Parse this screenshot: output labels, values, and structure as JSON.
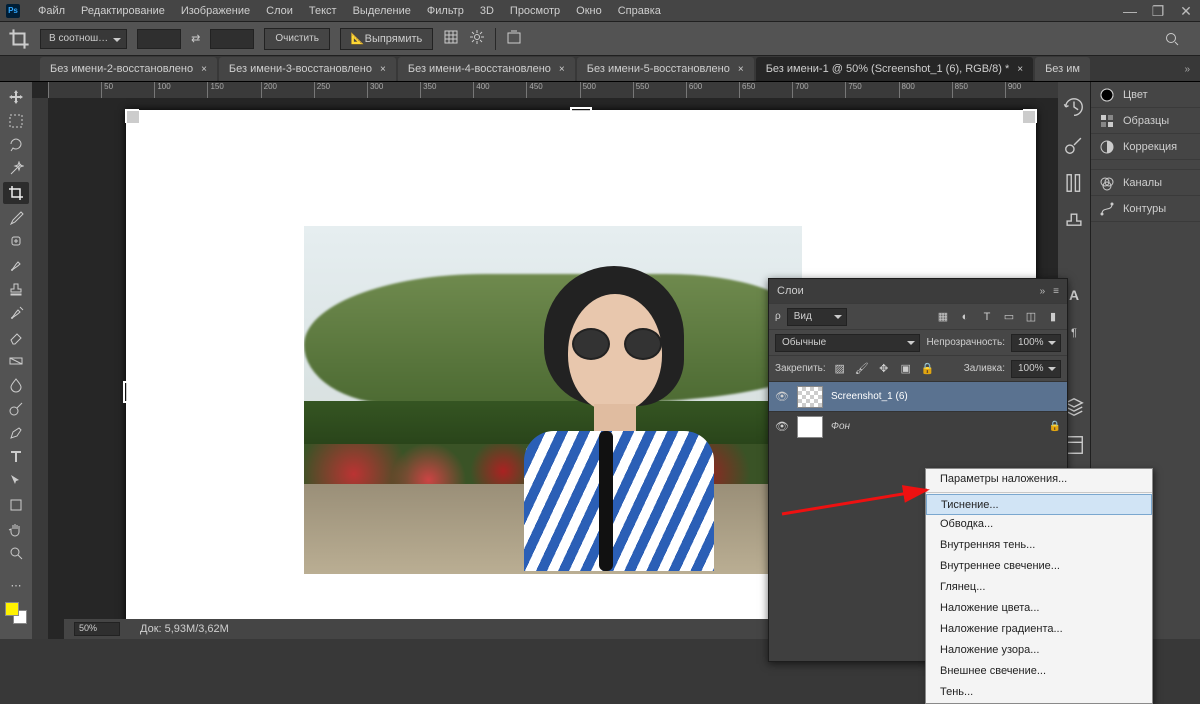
{
  "app": {
    "name": "Ps"
  },
  "menu": [
    "Файл",
    "Редактирование",
    "Изображение",
    "Слои",
    "Текст",
    "Выделение",
    "Фильтр",
    "3D",
    "Просмотр",
    "Окно",
    "Справка"
  ],
  "optbar": {
    "ratio_mode": "В соотнош…",
    "width": "",
    "height": "",
    "clear": "Очистить",
    "straighten": "Выпрямить"
  },
  "tabs": [
    {
      "label": "Без имени-2-восстановлено",
      "active": false
    },
    {
      "label": "Без имени-3-восстановлено",
      "active": false
    },
    {
      "label": "Без имени-4-восстановлено",
      "active": false
    },
    {
      "label": "Без имени-5-восстановлено",
      "active": false
    },
    {
      "label": "Без имени-1 @ 50% (Screenshot_1 (6), RGB/8) *",
      "active": true
    },
    {
      "label": "Без им",
      "active": false
    }
  ],
  "right_panels": [
    "Цвет",
    "Образцы",
    "Коррекция",
    "Каналы",
    "Контуры"
  ],
  "layers_panel": {
    "title": "Слои",
    "kind_label": "Вид",
    "blend_mode": "Обычные",
    "opacity_label": "Непрозрачность:",
    "opacity_value": "100%",
    "lock_label": "Закрепить:",
    "fill_label": "Заливка:",
    "fill_value": "100%",
    "layers": [
      {
        "name": "Screenshot_1 (6)",
        "thumb": "photo",
        "active": true,
        "locked": false
      },
      {
        "name": "Фон",
        "thumb": "white",
        "active": false,
        "locked": true
      }
    ]
  },
  "context_menu": {
    "items": [
      {
        "label": "Параметры наложения...",
        "hl": false
      },
      {
        "sep": true
      },
      {
        "label": "Тиснение...",
        "hl": true
      },
      {
        "label": "Обводка...",
        "hl": false
      },
      {
        "label": "Внутренняя тень...",
        "hl": false
      },
      {
        "label": "Внутреннее свечение...",
        "hl": false
      },
      {
        "label": "Глянец...",
        "hl": false
      },
      {
        "label": "Наложение цвета...",
        "hl": false
      },
      {
        "label": "Наложение градиента...",
        "hl": false
      },
      {
        "label": "Наложение узора...",
        "hl": false
      },
      {
        "label": "Внешнее свечение...",
        "hl": false
      },
      {
        "label": "Тень...",
        "hl": false
      }
    ]
  },
  "status": {
    "zoom": "50%",
    "doc_size": "Док: 5,93M/3,62M"
  },
  "ruler_marks": [
    "",
    "50",
    "100",
    "150",
    "200",
    "250",
    "300",
    "350",
    "400",
    "450",
    "500",
    "550",
    "600",
    "650",
    "700",
    "750",
    "800",
    "850",
    "900"
  ]
}
